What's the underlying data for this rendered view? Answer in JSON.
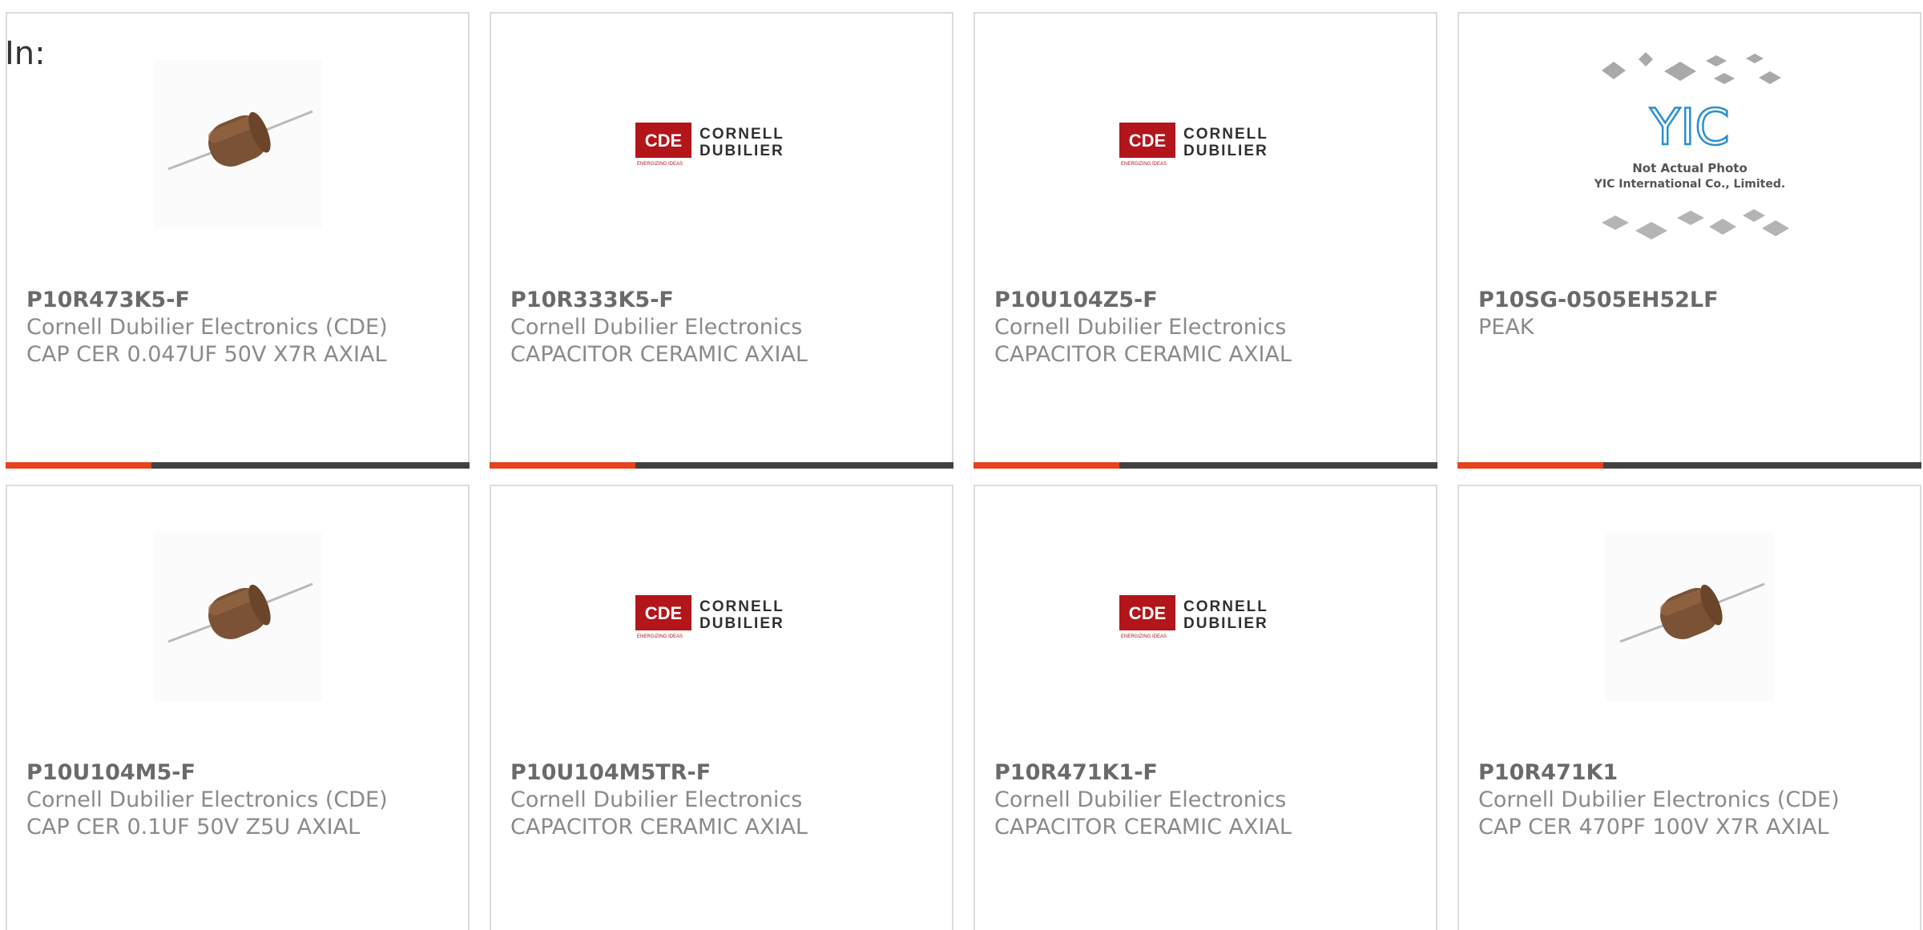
{
  "filter": {
    "label": "In:"
  },
  "colors": {
    "accent": "#e8411c",
    "bar": "#424242",
    "border": "#dcdcdc",
    "part_text": "#6a6a6a",
    "meta_text": "#8a8a8a"
  },
  "products": [
    {
      "part": "P10R473K5-F",
      "manufacturer": "Cornell Dubilier Electronics (CDE)",
      "description": "CAP CER 0.047UF 50V X7R AXIAL",
      "image": "axial-capacitor-photo"
    },
    {
      "part": "P10R333K5-F",
      "manufacturer": "Cornell Dubilier Electronics",
      "description": "CAPACITOR CERAMIC AXIAL",
      "image": "cde-logo"
    },
    {
      "part": "P10U104Z5-F",
      "manufacturer": "Cornell Dubilier Electronics",
      "description": "CAPACITOR CERAMIC AXIAL",
      "image": "cde-logo"
    },
    {
      "part": "P10SG-0505EH52LF",
      "manufacturer": "PEAK",
      "description": "",
      "image": "yic-placeholder"
    },
    {
      "part": "P10U104M5-F",
      "manufacturer": "Cornell Dubilier Electronics (CDE)",
      "description": "CAP CER 0.1UF 50V Z5U AXIAL",
      "image": "axial-capacitor-photo"
    },
    {
      "part": "P10U104M5TR-F",
      "manufacturer": "Cornell Dubilier Electronics",
      "description": "CAPACITOR CERAMIC AXIAL",
      "image": "cde-logo"
    },
    {
      "part": "P10R471K1-F",
      "manufacturer": "Cornell Dubilier Electronics",
      "description": "CAPACITOR CERAMIC AXIAL",
      "image": "cde-logo"
    },
    {
      "part": "P10R471K1",
      "manufacturer": "Cornell Dubilier Electronics (CDE)",
      "description": "CAP CER 470PF 100V X7R AXIAL",
      "image": "axial-capacitor-photo"
    }
  ],
  "logos": {
    "cde": {
      "badge": "CDE",
      "line1": "CORNELL",
      "line2": "DUBILIER",
      "tagline": "ENERGIZING IDEAS"
    },
    "yic": {
      "mark": "YIC",
      "line1": "Not Actual Photo",
      "line2": "YIC International Co., Limited."
    }
  }
}
